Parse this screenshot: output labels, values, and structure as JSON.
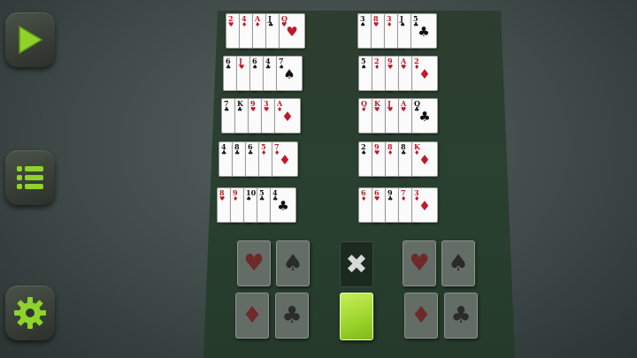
{
  "controls": {
    "play": {
      "icon": "play-icon",
      "color": "#8fd32a"
    },
    "menu": {
      "icon": "menu-icon",
      "color": "#8fd32a"
    },
    "settings": {
      "icon": "gear-icon",
      "color": "#8fd32a"
    }
  },
  "colors": {
    "accent": "#8fd32a",
    "felt": "#2b3e2e",
    "red_suit": "#c0182a"
  },
  "tableau_left": [
    [
      {
        "r": "2",
        "s": "♥"
      },
      {
        "r": "4",
        "s": "♦"
      },
      {
        "r": "A",
        "s": "♦"
      },
      {
        "r": "J",
        "s": "♣"
      },
      {
        "r": "Q",
        "s": "♥"
      }
    ],
    [
      {
        "r": "6",
        "s": "♣"
      },
      {
        "r": "J",
        "s": "♥"
      },
      {
        "r": "6",
        "s": "♠"
      },
      {
        "r": "4",
        "s": "♣"
      },
      {
        "r": "7",
        "s": "♠"
      }
    ],
    [
      {
        "r": "7",
        "s": "♣"
      },
      {
        "r": "K",
        "s": "♣"
      },
      {
        "r": "9",
        "s": "♥"
      },
      {
        "r": "3",
        "s": "♥"
      },
      {
        "r": "A",
        "s": "♦"
      }
    ],
    [
      {
        "r": "4",
        "s": "♣"
      },
      {
        "r": "8",
        "s": "♣"
      },
      {
        "r": "6",
        "s": "♣"
      },
      {
        "r": "5",
        "s": "♦"
      },
      {
        "r": "7",
        "s": "♦"
      }
    ],
    [
      {
        "r": "8",
        "s": "♥"
      },
      {
        "r": "9",
        "s": "♦"
      },
      {
        "r": "10",
        "s": "♠"
      },
      {
        "r": "5",
        "s": "♣"
      },
      {
        "r": "4",
        "s": "♣"
      }
    ]
  ],
  "tableau_right": [
    [
      {
        "r": "3",
        "s": "♠"
      },
      {
        "r": "8",
        "s": "♥"
      },
      {
        "r": "3",
        "s": "♦"
      },
      {
        "r": "J",
        "s": "♠"
      },
      {
        "r": "5",
        "s": "♣"
      }
    ],
    [
      {
        "r": "5",
        "s": "♠"
      },
      {
        "r": "2",
        "s": "♦"
      },
      {
        "r": "9",
        "s": "♥"
      },
      {
        "r": "A",
        "s": "♥"
      },
      {
        "r": "2",
        "s": "♦"
      }
    ],
    [
      {
        "r": "Q",
        "s": "♦"
      },
      {
        "r": "K",
        "s": "♥"
      },
      {
        "r": "J",
        "s": "♥"
      },
      {
        "r": "A",
        "s": "♥"
      },
      {
        "r": "Q",
        "s": "♣"
      }
    ],
    [
      {
        "r": "2",
        "s": "♠"
      },
      {
        "r": "9",
        "s": "♥"
      },
      {
        "r": "8",
        "s": "♦"
      },
      {
        "r": "8",
        "s": "♣"
      },
      {
        "r": "K",
        "s": "♦"
      }
    ],
    [
      {
        "r": "6",
        "s": "♦"
      },
      {
        "r": "6",
        "s": "♥"
      },
      {
        "r": "9",
        "s": "♣"
      },
      {
        "r": "7",
        "s": "♦"
      },
      {
        "r": "3",
        "s": "♦"
      }
    ]
  ],
  "foundations": [
    {
      "suit": "♥",
      "color": "r"
    },
    {
      "suit": "♠",
      "color": "b"
    },
    {
      "suit": "♦",
      "color": "r"
    },
    {
      "suit": "♣",
      "color": "b"
    },
    {
      "suit": "♥",
      "color": "r"
    },
    {
      "suit": "♠",
      "color": "b"
    },
    {
      "suit": "♦",
      "color": "r"
    },
    {
      "suit": "♣",
      "color": "b"
    }
  ],
  "discard": {
    "symbol": "✖"
  },
  "stock": {
    "back_color": "#9bd32a"
  }
}
